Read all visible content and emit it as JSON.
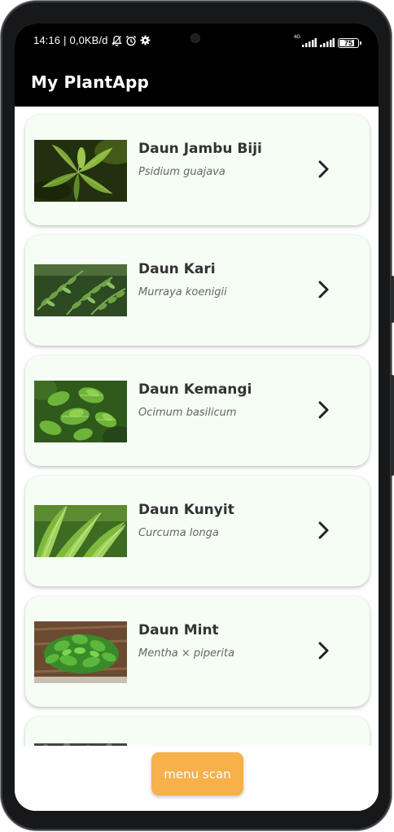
{
  "status_bar": {
    "time": "14:16",
    "network_speed": "0,0KB/d",
    "network_type": "4G",
    "battery": "75",
    "icons": [
      "mute-bell-icon",
      "alarm-icon",
      "settings-gear-icon",
      "signal-icon",
      "signal-icon",
      "battery-icon"
    ]
  },
  "app_bar": {
    "title": "My PlantApp"
  },
  "plants": [
    {
      "name": "Daun Jambu Biji",
      "scientific": "Psidium guajava"
    },
    {
      "name": "Daun Kari",
      "scientific": "Murraya koenigii"
    },
    {
      "name": "Daun Kemangi",
      "scientific": "Ocimum basilicum"
    },
    {
      "name": "Daun Kunyit",
      "scientific": "Curcuma longa"
    },
    {
      "name": "Daun Mint",
      "scientific": "Mentha × piperita"
    }
  ],
  "bottom": {
    "scan_label": "menu scan"
  },
  "colors": {
    "app_bar": "#000000",
    "card_bg": "#f5fdf5",
    "scan_button": "#f7b04a",
    "title_text": "#333333",
    "subtitle_text": "#666666"
  }
}
